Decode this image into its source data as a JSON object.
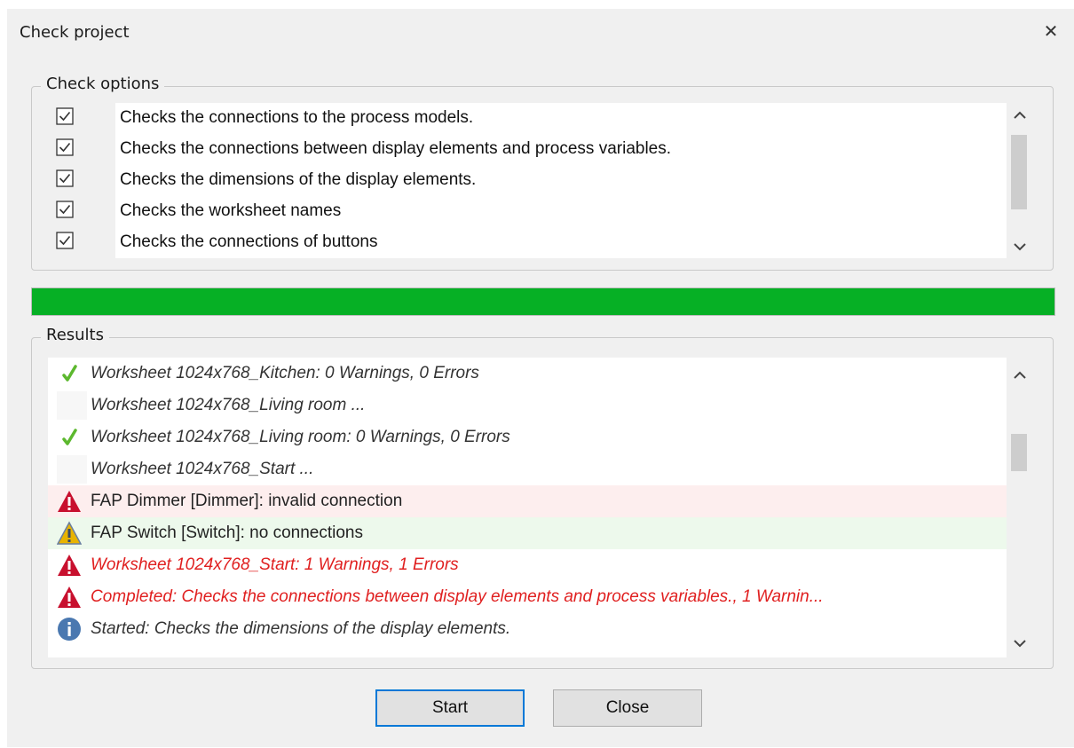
{
  "window": {
    "title": "Check project",
    "close_glyph": "✕"
  },
  "check_options": {
    "legend": "Check options",
    "items": [
      {
        "checked": true,
        "label": "Checks the connections to the process models."
      },
      {
        "checked": true,
        "label": "Checks the connections between display elements and process variables."
      },
      {
        "checked": true,
        "label": "Checks the dimensions of the display elements."
      },
      {
        "checked": true,
        "label": "Checks the worksheet names"
      },
      {
        "checked": true,
        "label": "Checks the connections of buttons"
      }
    ]
  },
  "progress": {
    "value": 1.0,
    "color": "#06b025"
  },
  "results": {
    "legend": "Results",
    "rows": [
      {
        "icon": "success-check-icon",
        "text": "Worksheet 1024x768_Kitchen: 0 Warnings, 0 Errors",
        "italic": true,
        "color": "#333333",
        "bg": "#ffffff"
      },
      {
        "icon": "none",
        "text": "Worksheet 1024x768_Living room ...",
        "italic": true,
        "color": "#333333",
        "bg": "#ffffff"
      },
      {
        "icon": "success-check-icon",
        "text": "Worksheet 1024x768_Living room: 0 Warnings, 0 Errors",
        "italic": true,
        "color": "#333333",
        "bg": "#ffffff"
      },
      {
        "icon": "none",
        "text": "Worksheet 1024x768_Start ...",
        "italic": true,
        "color": "#333333",
        "bg": "#ffffff"
      },
      {
        "icon": "error-triangle-icon",
        "text": "FAP Dimmer [Dimmer]: invalid connection",
        "italic": false,
        "color": "#222222",
        "bg": "#fdeeee"
      },
      {
        "icon": "warning-triangle-icon",
        "text": "FAP Switch [Switch]: no connections",
        "italic": false,
        "color": "#222222",
        "bg": "#edf9ec"
      },
      {
        "icon": "error-triangle-icon",
        "text": "Worksheet 1024x768_Start: 1 Warnings, 1 Errors",
        "italic": true,
        "color": "#e02020",
        "bg": "#ffffff"
      },
      {
        "icon": "error-triangle-icon",
        "text": "Completed: Checks the connections between display elements and process variables., 1 Warnin...",
        "italic": true,
        "color": "#e02020",
        "bg": "#ffffff"
      },
      {
        "icon": "info-circle-icon",
        "text": "Started: Checks the dimensions of the display elements.",
        "italic": true,
        "color": "#333333",
        "bg": "#ffffff"
      }
    ]
  },
  "buttons": {
    "start": "Start",
    "close": "Close"
  },
  "colors": {
    "error": "#c8102e",
    "warning": "#e8b400",
    "success": "#5cb82e",
    "info": "#4a78b0",
    "default_button_border": "#0078d7"
  }
}
